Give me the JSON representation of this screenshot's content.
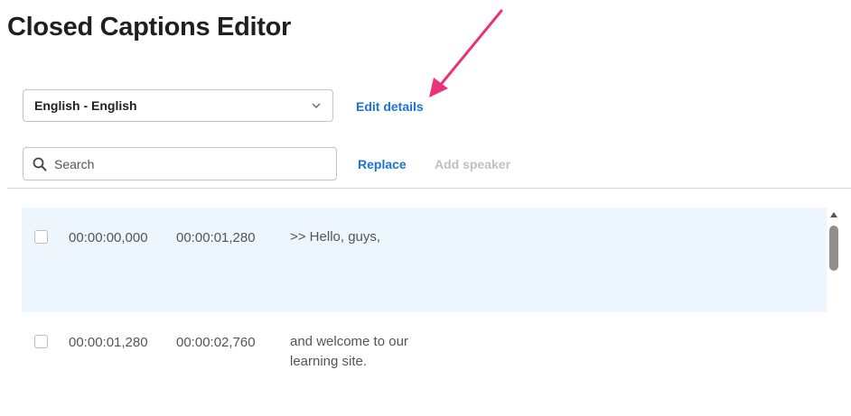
{
  "page": {
    "title": "Closed Captions Editor"
  },
  "language_select": {
    "value": "English - English",
    "chevron_icon": "chevron-down-icon"
  },
  "toolbar": {
    "edit_details_label": "Edit details",
    "search_placeholder": "Search",
    "replace_label": "Replace",
    "add_speaker_label": "Add speaker"
  },
  "annotation": {
    "arrow_color": "#e8337a"
  },
  "captions": [
    {
      "start": "00:00:00,000",
      "end": "00:00:01,280",
      "text": ">> Hello, guys,",
      "selected": true
    },
    {
      "start": "00:00:01,280",
      "end": "00:00:02,760",
      "text": "and welcome to our learning site.",
      "selected": false
    }
  ],
  "colors": {
    "link": "#1a73d6",
    "disabled": "#c0c0c0",
    "selected_row": "#eef6fd"
  }
}
